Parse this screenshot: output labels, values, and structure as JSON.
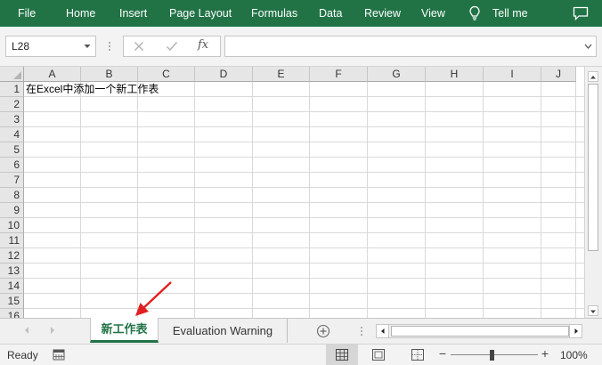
{
  "ribbon": {
    "tabs": [
      "File",
      "Home",
      "Insert",
      "Page Layout",
      "Formulas",
      "Data",
      "Review",
      "View"
    ],
    "tell_me": "Tell me",
    "color": "#217346"
  },
  "formula_bar": {
    "name_box": "L28",
    "formula": ""
  },
  "sheet": {
    "columns": [
      "A",
      "B",
      "C",
      "D",
      "E",
      "F",
      "G",
      "H",
      "I",
      "J"
    ],
    "rows": [
      "1",
      "2",
      "3",
      "4",
      "5",
      "6",
      "7",
      "8",
      "9",
      "10",
      "11",
      "12",
      "13",
      "14",
      "15",
      "16"
    ],
    "cell_a1": "在Excel中添加一个新工作表"
  },
  "sheet_tabs": {
    "active": "新工作表",
    "other": "Evaluation Warning"
  },
  "status": {
    "ready": "Ready",
    "zoom": "100%"
  },
  "annotation": {
    "arrow_color": "#e02020"
  }
}
